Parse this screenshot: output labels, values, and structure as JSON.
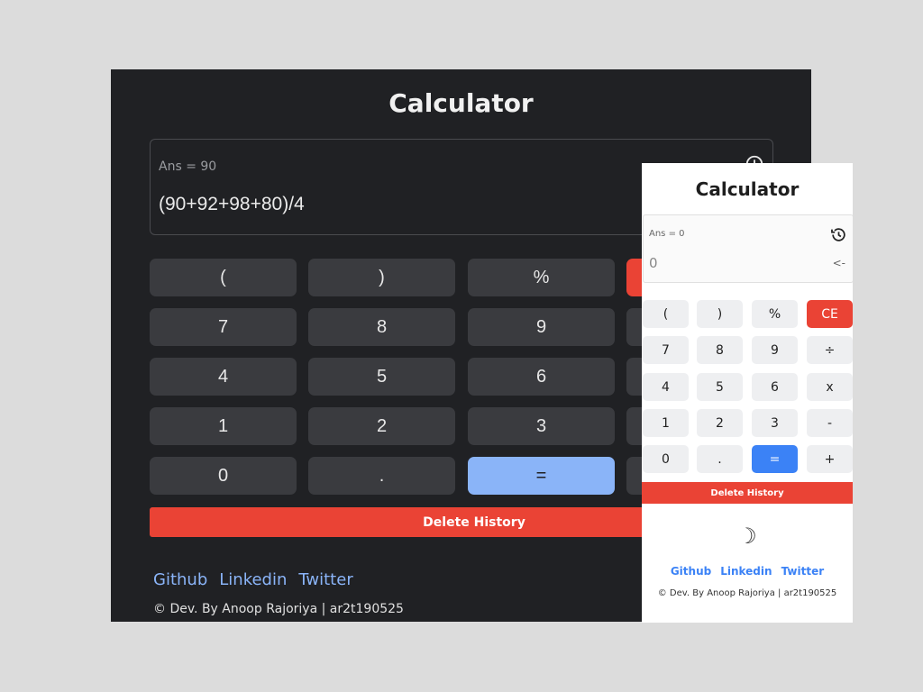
{
  "dark": {
    "title": "Calculator",
    "display": {
      "ans": "Ans = 90",
      "expression": "(90+92+98+80)/4"
    },
    "keys": [
      [
        "(",
        ")",
        "%",
        ""
      ],
      [
        "7",
        "8",
        "9",
        ""
      ],
      [
        "4",
        "5",
        "6",
        ""
      ],
      [
        "1",
        "2",
        "3",
        ""
      ],
      [
        "0",
        ".",
        "=",
        ""
      ]
    ],
    "delete_history": "Delete History",
    "links": [
      "Github",
      "Linkedin",
      "Twitter"
    ],
    "credit": "© Dev. By Anoop Rajoriya | ar2t190525"
  },
  "light": {
    "title": "Calculator",
    "display": {
      "ans": "Ans = 0",
      "current": "0",
      "backspace": "<-"
    },
    "keys": [
      [
        "(",
        ")",
        "%",
        "CE"
      ],
      [
        "7",
        "8",
        "9",
        "÷"
      ],
      [
        "4",
        "5",
        "6",
        "x"
      ],
      [
        "1",
        "2",
        "3",
        "-"
      ],
      [
        "0",
        ".",
        "=",
        "+"
      ]
    ],
    "delete_history": "Delete History",
    "theme_toggle": "☽",
    "links": [
      "Github",
      "Linkedin",
      "Twitter"
    ],
    "credit": "© Dev. By Anoop Rajoriya | ar2t190525"
  },
  "colors": {
    "dark_bg": "#202124",
    "dark_key": "#3a3b3f",
    "dark_equals": "#8ab4f8",
    "danger": "#ea4335",
    "light_equals": "#3b82f6",
    "link_dark": "#8ab4f8",
    "link_light": "#3b82f6"
  },
  "icons": {
    "history": "history-icon",
    "theme": "moon-icon"
  }
}
